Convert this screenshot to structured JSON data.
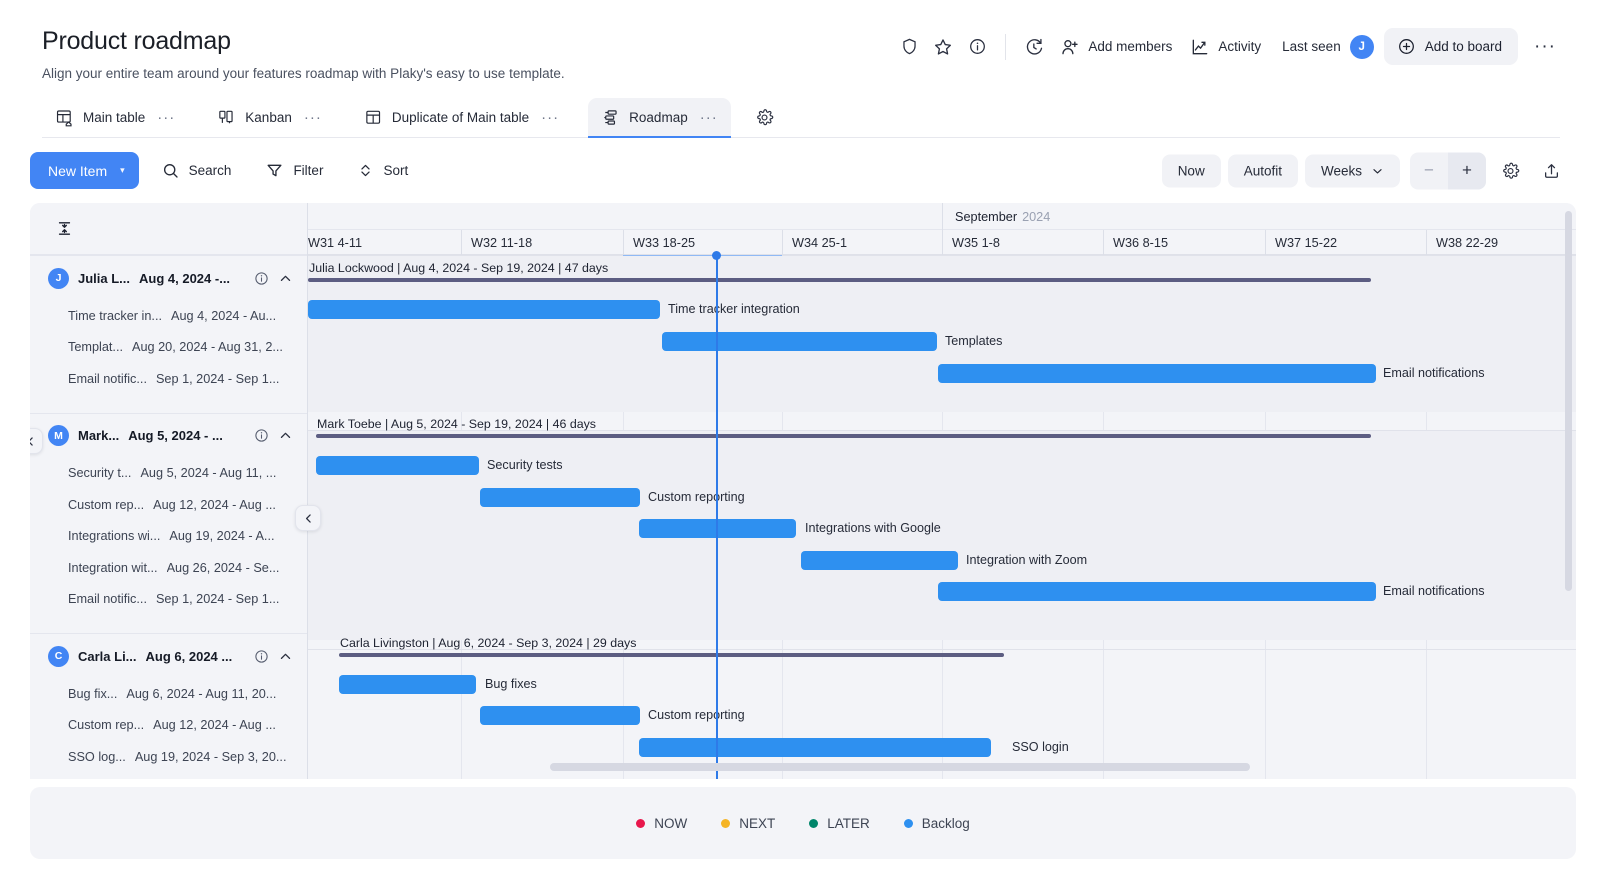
{
  "header": {
    "title": "Product roadmap",
    "subtitle": "Align your entire team around your features roadmap with Plaky's easy to use template.",
    "actions": {
      "shield_icon": "shield-icon",
      "star_icon": "star-icon",
      "info_icon": "info-icon",
      "refresh_icon": "activity-refresh-icon",
      "add_members": "Add members",
      "activity": "Activity",
      "last_seen": "Last seen",
      "last_seen_avatar": "J",
      "add_to_board": "Add to board",
      "more": "···"
    }
  },
  "tabs": [
    {
      "label": "Main table",
      "icon": "table-home-icon",
      "dots": "···",
      "active": false
    },
    {
      "label": "Kanban",
      "icon": "kanban-icon",
      "dots": "···",
      "active": false
    },
    {
      "label": "Duplicate of Main table",
      "icon": "table-icon",
      "dots": "···",
      "active": false
    },
    {
      "label": "Roadmap",
      "icon": "roadmap-icon",
      "dots": "···",
      "active": true
    }
  ],
  "tabs_settings_icon": "gear-icon",
  "toolbar": {
    "new_item": "New Item",
    "new_item_caret": "▾",
    "search": "Search",
    "filter": "Filter",
    "sort": "Sort",
    "now": "Now",
    "autofit": "Autofit",
    "zoom_unit": "Weeks",
    "zoom_unit_caret": "⌄",
    "zoom_out": "−",
    "zoom_in": "+",
    "settings_icon": "gear-icon",
    "export_icon": "upload-export-icon"
  },
  "timeline": {
    "collapse_rows_icon": "collapse-rows-icon",
    "months": [
      {
        "name": "September",
        "year": "2024"
      }
    ],
    "weeks": [
      "W31 4-11",
      "W32 11-18",
      "W33 18-25",
      "W34 25-1",
      "W35 1-8",
      "W36 8-15",
      "W37 15-22",
      "W38 22-29"
    ]
  },
  "groups": [
    {
      "avatar": "J",
      "name": "Julia L...",
      "dates": "Aug 4, 2024 -...",
      "info_icon": "info-icon",
      "chevron_icon": "chevron-up-icon",
      "summary_label": "Julia Lockwood | Aug 4, 2024 - Sep 19, 2024 | 47 days",
      "tasks": [
        {
          "name": "Time tracker in...",
          "dates": "Aug 4, 2024 - Au...",
          "bar_label": "Time tracker integration"
        },
        {
          "name": "Templat...",
          "dates": "Aug 20, 2024 - Aug 31, 2...",
          "bar_label": "Templates"
        },
        {
          "name": "Email notific...",
          "dates": "Sep 1, 2024 - Sep 1...",
          "bar_label": "Email notifications"
        }
      ]
    },
    {
      "avatar": "M",
      "name": "Mark...",
      "dates": "Aug 5, 2024 - ...",
      "info_icon": "info-icon",
      "chevron_icon": "chevron-up-icon",
      "summary_label": "Mark Toebe | Aug 5, 2024 - Sep 19, 2024 | 46 days",
      "tasks": [
        {
          "name": "Security t...",
          "dates": "Aug 5, 2024 - Aug 11, ...",
          "bar_label": "Security tests"
        },
        {
          "name": "Custom rep...",
          "dates": "Aug 12, 2024 - Aug ...",
          "bar_label": "Custom reporting"
        },
        {
          "name": "Integrations wi...",
          "dates": "Aug 19, 2024 - A...",
          "bar_label": "Integrations with Google"
        },
        {
          "name": "Integration wit...",
          "dates": "Aug 26, 2024 - Se...",
          "bar_label": "Integration with Zoom"
        },
        {
          "name": "Email notific...",
          "dates": "Sep 1, 2024 - Sep 1...",
          "bar_label": "Email notifications"
        }
      ]
    },
    {
      "avatar": "C",
      "name": "Carla Li...",
      "dates": "Aug 6, 2024 ...",
      "info_icon": "info-icon",
      "chevron_icon": "chevron-up-icon",
      "summary_label": "Carla Livingston | Aug 6, 2024 - Sep 3, 2024 | 29 days",
      "tasks": [
        {
          "name": "Bug fix...",
          "dates": "Aug 6, 2024 - Aug 11, 20...",
          "bar_label": "Bug fixes"
        },
        {
          "name": "Custom rep...",
          "dates": "Aug 12, 2024 - Aug ...",
          "bar_label": "Custom reporting"
        },
        {
          "name": "SSO log...",
          "dates": "Aug 19, 2024 - Sep 3, 20...",
          "bar_label": "SSO login"
        }
      ]
    }
  ],
  "legend": [
    {
      "label": "NOW",
      "color": "#e8174c"
    },
    {
      "label": "NEXT",
      "color": "#f5b425"
    },
    {
      "label": "LATER",
      "color": "#00866b"
    },
    {
      "label": "Backlog",
      "color": "#2e90f0"
    }
  ],
  "colors": {
    "accent": "#4285f4",
    "bar": "#2e90f0",
    "summary_bar": "#5c5d82",
    "today": "#2e7ae8",
    "surface": "#f3f4f8"
  }
}
